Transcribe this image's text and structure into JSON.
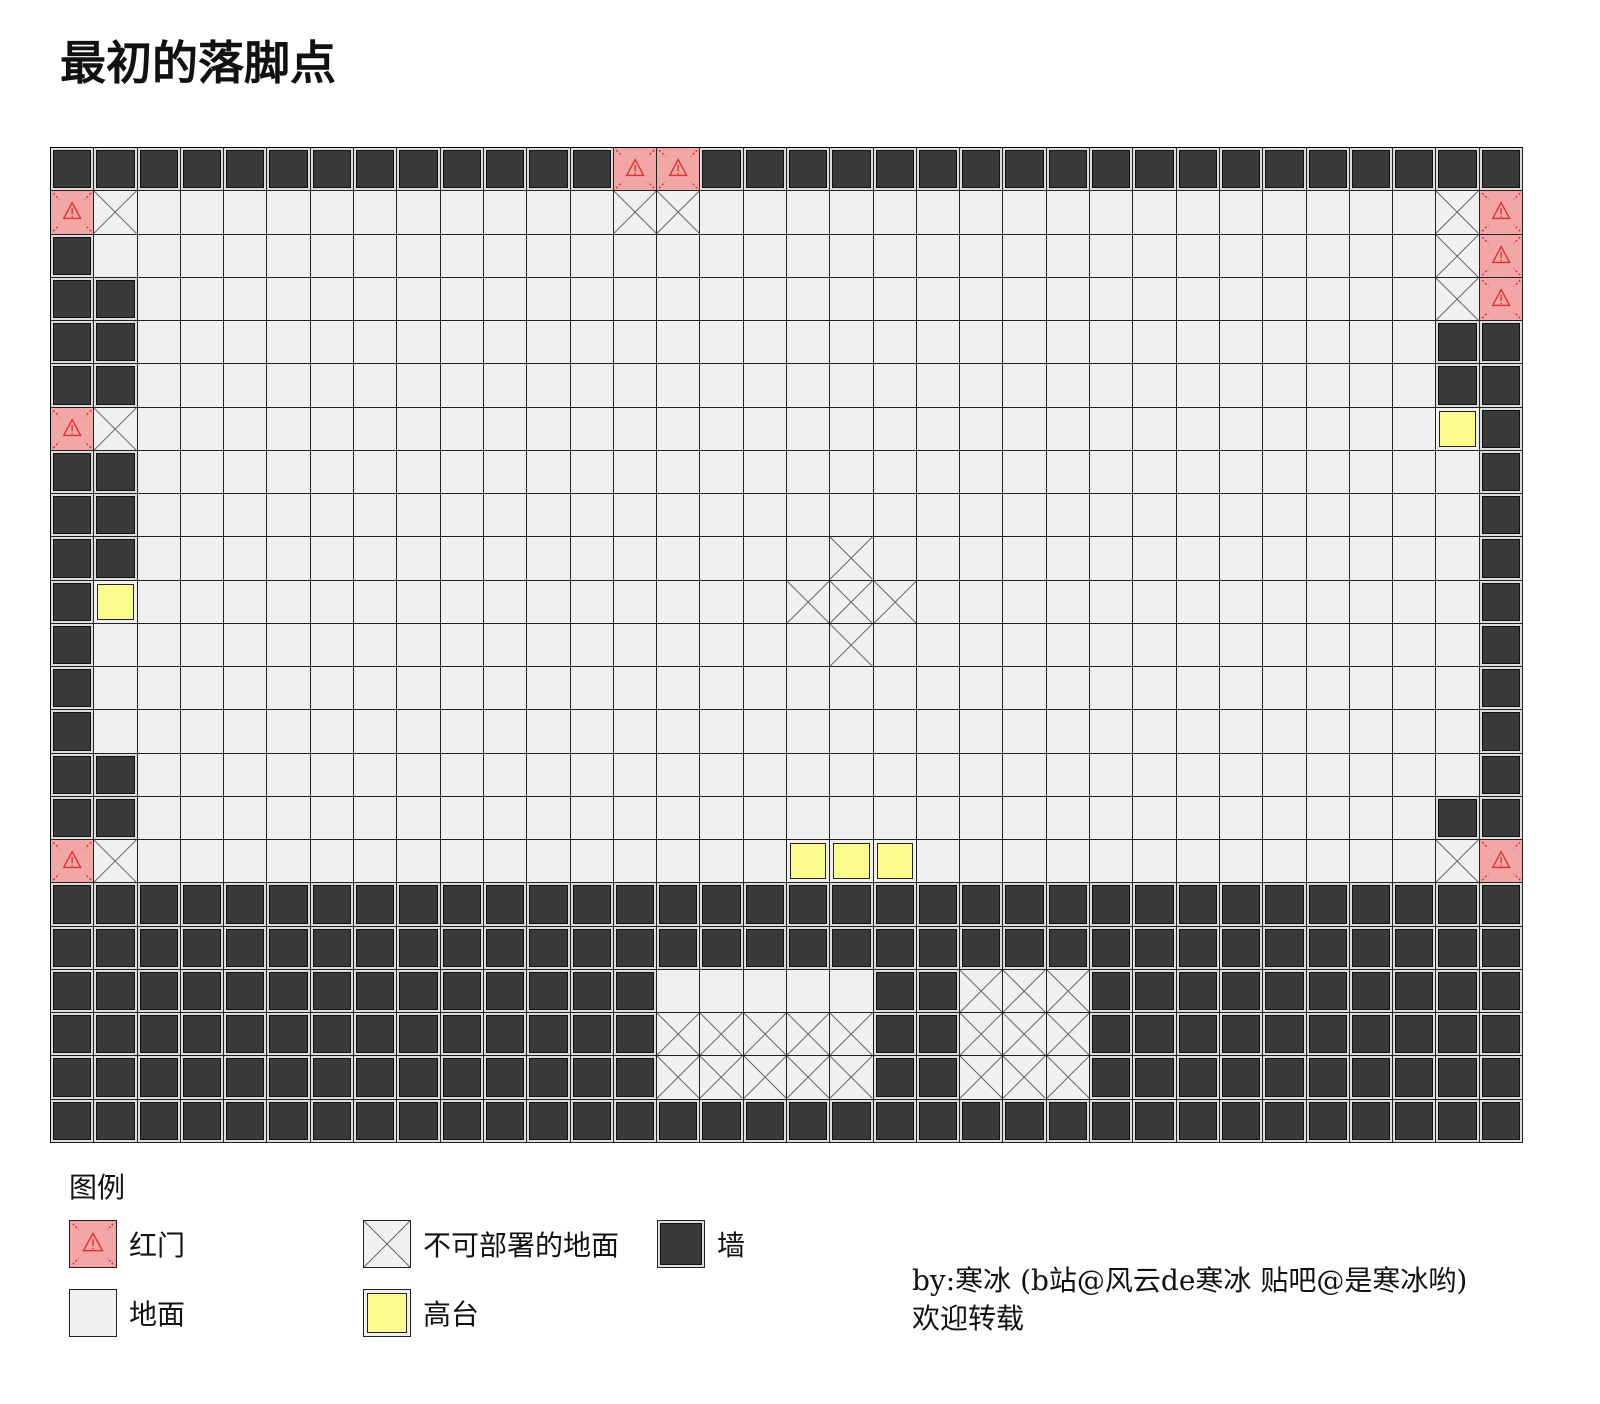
{
  "title": "最初的落脚点",
  "grid": {
    "rows": [
      "WWWWWWWWWWWWWRRWWWWWWWWWWWWWWWWWWW",
      "RNGGGGGGGGGGGNNGGGGGGGGGGGGGGGGGNR",
      "WGGGGGGGGGGGGGGGGGGGGGGGGGGGGGGGNR",
      "WWGGGGGGGGGGGGGGGGGGGGGGGGGGGGGGNR",
      "WWGGGGGGGGGGGGGGGGGGGGGGGGGGGGGGWW",
      "WWGGGGGGGGGGGGGGGGGGGGGGGGGGGGGGWW",
      "RNGGGGGGGGGGGGGGGGGGGGGGGGGGGGGGHW",
      "WWGGGGGGGGGGGGGGGGGGGGGGGGGGGGGGGW",
      "WWGGGGGGGGGGGGGGGGGGGGGGGGGGGGGGGW",
      "WWGGGGGGGGGGGGGGGGNGGGGGGGGGGGGGGW",
      "WHGGGGGGGGGGGGGGGNNNGGGGGGGGGGGGGW",
      "WGGGGGGGGGGGGGGGGGNGGGGGGGGGGGGGGW",
      "WGGGGGGGGGGGGGGGGGGGGGGGGGGGGGGGGW",
      "WGGGGGGGGGGGGGGGGGGGGGGGGGGGGGGGGW",
      "WWGGGGGGGGGGGGGGGGGGGGGGGGGGGGGGGW",
      "WWGGGGGGGGGGGGGGGGGGGGGGGGGGGGGGWW",
      "RNGGGGGGGGGGGGGGGHHHGGGGGGGGGGGGNR",
      "WWWWWWWWWWWWWWWWWWWWWWWWWWWWWWWWWW",
      "WWWWWWWWWWWWWWWWWWWWWWWWWWWWWWWWWW",
      "WWWWWWWWWWWWWWGGGGGWWNNNWWWWWWWWWW",
      "WWWWWWWWWWWWWWNNNNNWWNNNWWWWWWWWWW",
      "WWWWWWWWWWWWWWNNNNNWWNNNWWWWWWWWWW",
      "WWWWWWWWWWWWWWWWWWWWWWWWWWWWWWWWWW"
    ]
  },
  "legend": {
    "title": "图例",
    "red_gate": "红门",
    "no_deploy": "不可部署的地面",
    "wall": "墙",
    "ground": "地面",
    "high_ground": "高台"
  },
  "credit": {
    "line1": "by:寒冰 (b站@风云de寒冰 贴吧@是寒冰哟)",
    "line2": "欢迎转载"
  },
  "colors": {
    "wall": "#3a3a3a",
    "ground": "#f0f0f0",
    "high_ground": "#fbfb8e",
    "red_gate": "#f2a6a6",
    "warning": "#e03030"
  }
}
